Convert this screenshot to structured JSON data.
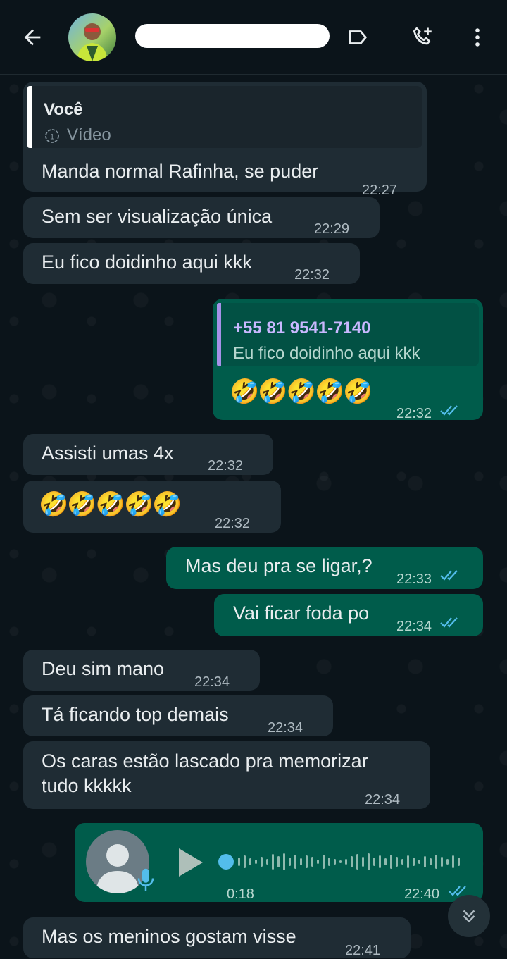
{
  "header": {
    "back_icon": "arrow-left-icon",
    "contact_name_redacted": true,
    "icons": [
      "label-icon",
      "add-call-icon",
      "more-vert-icon"
    ]
  },
  "messages": [
    {
      "dir": "in",
      "quote": {
        "author": "Você",
        "type_icon": "view-once-icon",
        "type_label": "Vídeo"
      },
      "text": "Manda normal Rafinha, se puder",
      "time": "22:27"
    },
    {
      "dir": "in",
      "text": "Sem ser visualização única",
      "time": "22:29"
    },
    {
      "dir": "in",
      "text": "Eu fico doidinho aqui kkk",
      "time": "22:32"
    },
    {
      "dir": "out",
      "quote": {
        "author": "+55 81 9541-7140",
        "text": "Eu fico doidinho aqui kkk"
      },
      "text": "🤣🤣🤣🤣🤣",
      "time": "22:32",
      "read": true
    },
    {
      "dir": "in",
      "text": "Assisti umas 4x",
      "time": "22:32"
    },
    {
      "dir": "in",
      "text": "🤣🤣🤣🤣🤣",
      "time": "22:32"
    },
    {
      "dir": "out",
      "text": "Mas deu pra se ligar,?",
      "time": "22:33",
      "read": true
    },
    {
      "dir": "out",
      "text": "Vai ficar foda po",
      "time": "22:34",
      "read": true
    },
    {
      "dir": "in",
      "text": "Deu sim mano",
      "time": "22:34"
    },
    {
      "dir": "in",
      "text": "Tá ficando top demais",
      "time": "22:34"
    },
    {
      "dir": "in",
      "lines": [
        "Os caras estão lascado pra memorizar",
        "tudo kkkkk"
      ],
      "time": "22:34"
    },
    {
      "dir": "out",
      "voice": {
        "duration": "0:18",
        "progress": 0.0
      },
      "time": "22:40",
      "read": true
    },
    {
      "dir": "in",
      "text": "Mas os meninos gostam visse",
      "time": "22:41"
    }
  ],
  "colors": {
    "background": "#0b141a",
    "incoming_bubble": "#1f2c34",
    "outgoing_bubble": "#005c4b",
    "read_ticks": "#53bdeb",
    "quote_bar_you": "#ffffff",
    "quote_bar_contact": "#a791e8"
  }
}
